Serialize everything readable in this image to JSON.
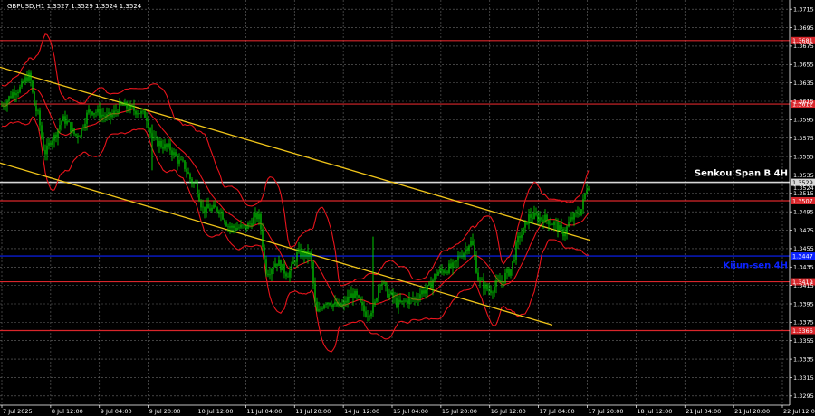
{
  "chart_data": {
    "type": "candlestick",
    "title": "GBPUSD,H1  1.3527 1.3529 1.3524 1.3524",
    "ylim": [
      1.3285,
      1.3725
    ],
    "y_ticks": [
      "1.3715",
      "1.3695",
      "1.3675",
      "1.3655",
      "1.3635",
      "1.3615",
      "1.3595",
      "1.3575",
      "1.3555",
      "1.3535",
      "1.3515",
      "1.3495",
      "1.3475",
      "1.3455",
      "1.3435",
      "1.3415",
      "1.3395",
      "1.3375",
      "1.3355",
      "1.3335",
      "1.3315",
      "1.3295"
    ],
    "x_ticks": [
      "7 Jul 2025",
      "8 Jul 12:00",
      "9 Jul 04:00",
      "9 Jul 20:00",
      "10 Jul 12:00",
      "11 Jul 04:00",
      "11 Jul 20:00",
      "14 Jul 12:00",
      "15 Jul 04:00",
      "15 Jul 20:00",
      "16 Jul 12:00",
      "17 Jul 04:00",
      "17 Jul 20:00",
      "18 Jul 12:00",
      "21 Jul 04:00",
      "21 Jul 20:00",
      "22 Jul 12:00"
    ],
    "horizontal_levels": [
      {
        "price": 1.3681,
        "color": "#d9262b",
        "label": "1.3681"
      },
      {
        "price": 1.3612,
        "color": "#d9262b",
        "label": "1.3612"
      },
      {
        "price": 1.3527,
        "color": "#d8d8d8",
        "label": "1.3529"
      },
      {
        "price": 1.3507,
        "color": "#d9262b",
        "label": "1.3507"
      },
      {
        "price": 1.3447,
        "color": "#0b22ff",
        "label": "1.3447"
      },
      {
        "price": 1.3419,
        "color": "#d9262b",
        "label": "1.3419"
      },
      {
        "price": 1.3366,
        "color": "#d9262b",
        "label": "1.3366"
      }
    ],
    "price_labels": [
      {
        "price": 1.3521,
        "text": "1.3524",
        "color": "#ffffff"
      }
    ],
    "annotations": [
      {
        "text": "Senkou Span B 4H",
        "price": 1.3532,
        "color": "#ffffff"
      },
      {
        "text": "Kijun-sen 4H",
        "price": 1.3432,
        "color": "#0b22ff"
      }
    ],
    "channel_lines": [
      {
        "name": "upper",
        "from": [
          0,
          1.3652
        ],
        "to": [
          652,
          1.3464
        ]
      },
      {
        "name": "lower",
        "from": [
          0,
          1.3548
        ],
        "to": [
          610,
          1.3372
        ]
      }
    ],
    "colors": {
      "background": "#000000",
      "grid": "#6a6a6a",
      "candle": "#00e000",
      "bollinger": "#e8141c",
      "channel": "#f0c419"
    }
  }
}
